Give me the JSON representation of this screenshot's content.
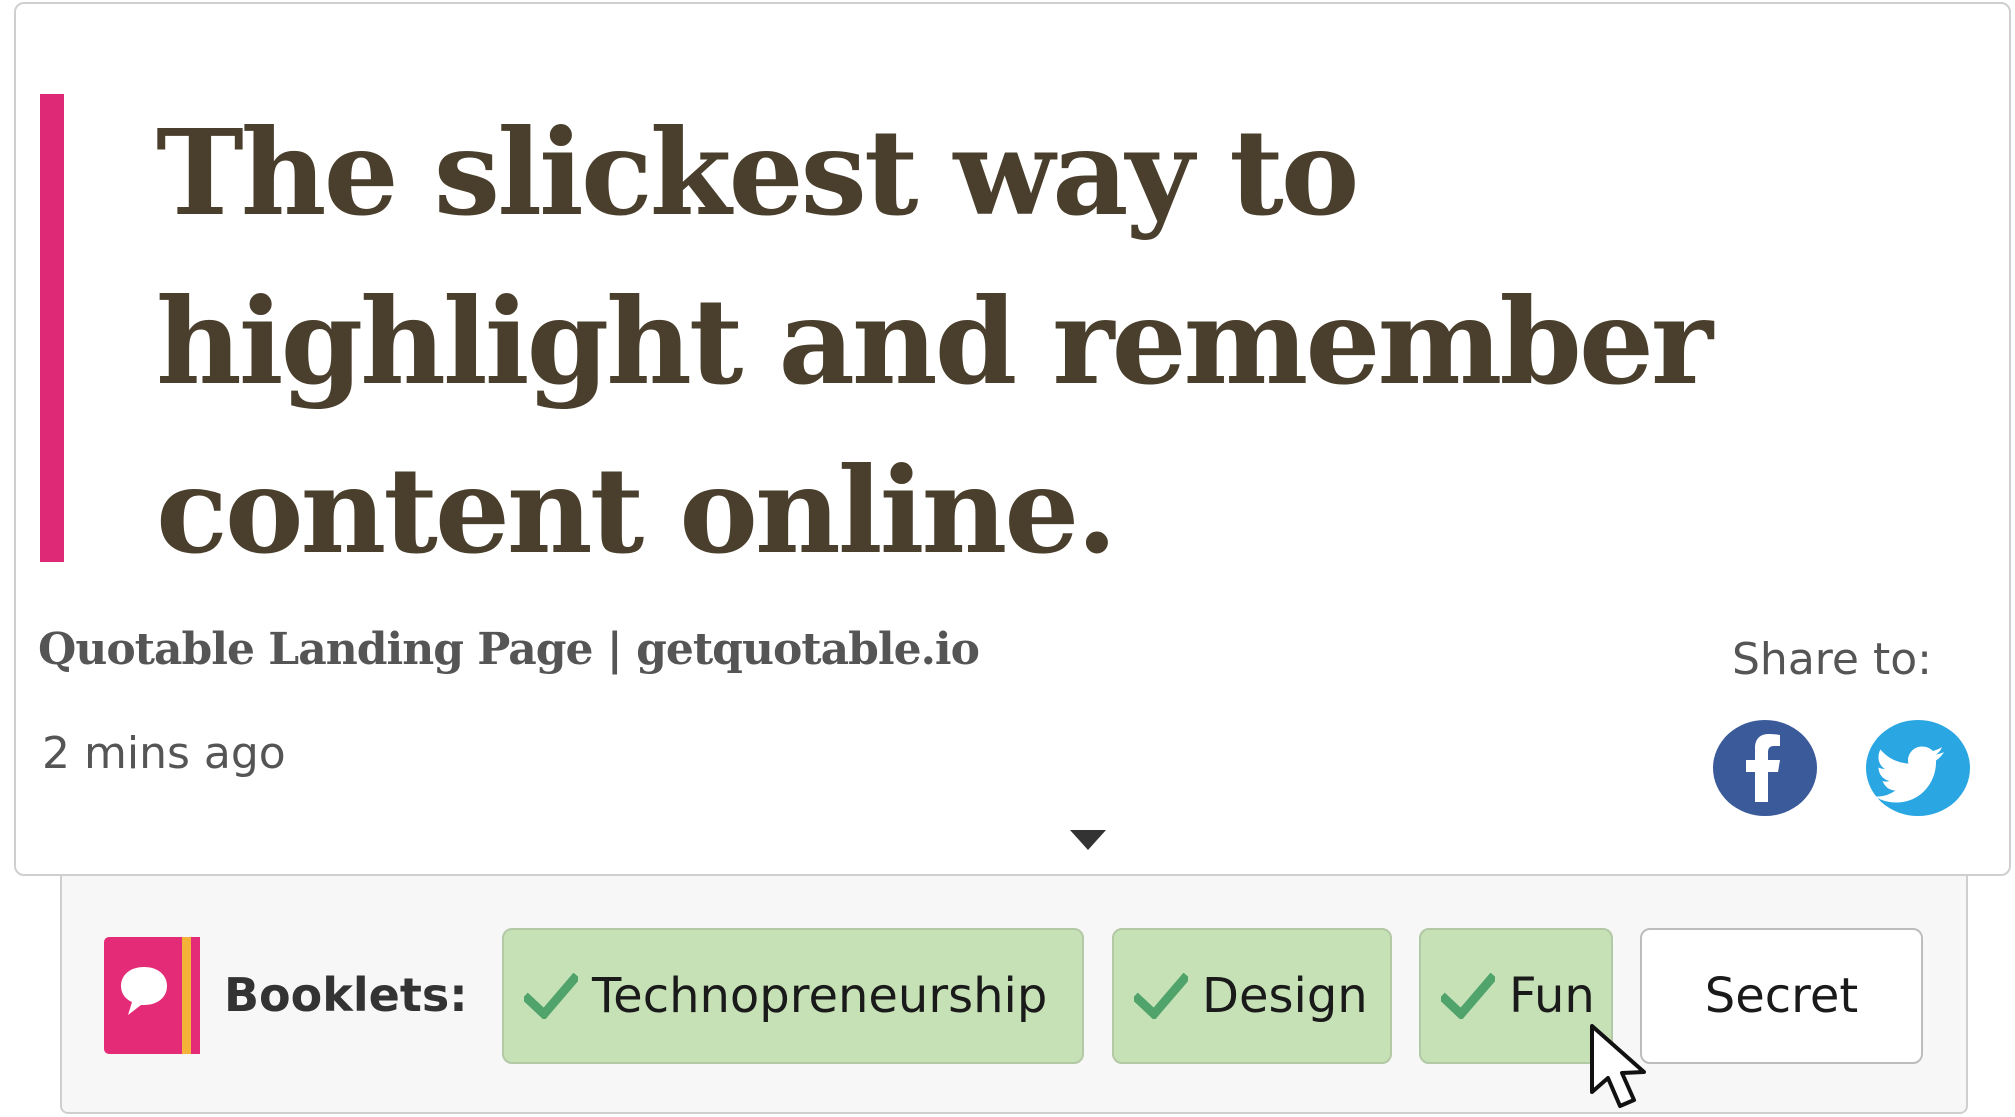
{
  "quote": {
    "lines": [
      "The slickest way to",
      "highlight and remember",
      "content online."
    ],
    "accent_color": "#de2a76"
  },
  "source": {
    "title": "Quotable Landing Page | getquotable.io",
    "timestamp": "2 mins ago"
  },
  "share": {
    "label": "Share to:",
    "buttons": [
      {
        "name": "facebook",
        "icon": "facebook-icon",
        "color": "#3b5a9a"
      },
      {
        "name": "twitter",
        "icon": "twitter-icon",
        "color": "#2aa6e2"
      }
    ]
  },
  "expand_icon": "caret-down-icon",
  "booklets": {
    "logo_icon": "speech-bubble-book-icon",
    "label": "Booklets:",
    "tags": [
      {
        "label": "Technopreneurship",
        "selected": true
      },
      {
        "label": "Design",
        "selected": true
      },
      {
        "label": "Fun",
        "selected": true
      },
      {
        "label": "Secret",
        "selected": false
      }
    ],
    "selected_color": "#c6e1b6",
    "check_color": "#4fa36b"
  },
  "cursor_icon": "mouse-pointer-icon"
}
